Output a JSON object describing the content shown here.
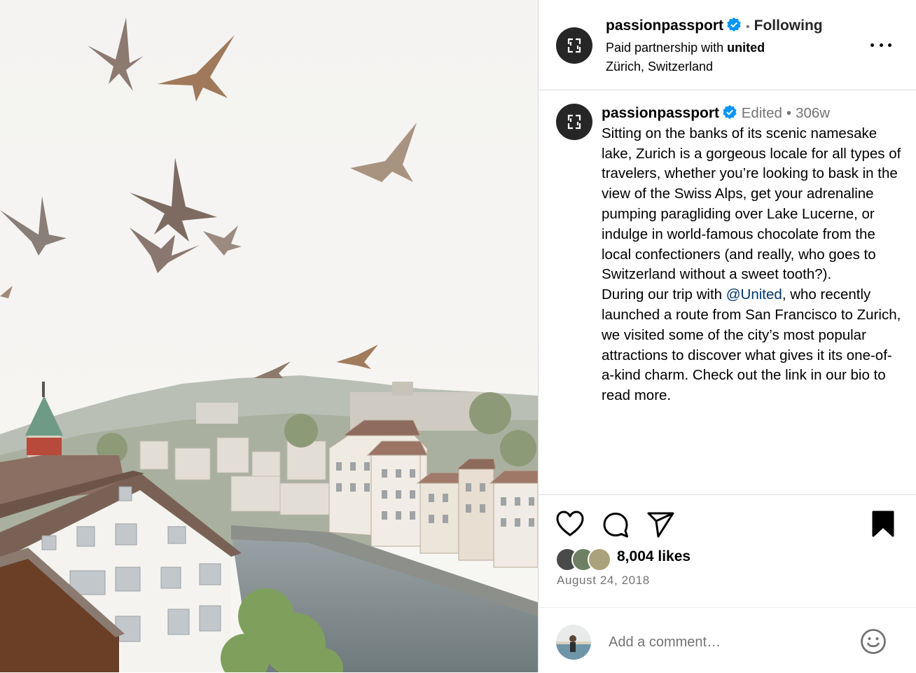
{
  "post": {
    "author": {
      "username": "passionpassport",
      "verified": true,
      "follow_status": "Following",
      "separator": "•",
      "partnership_prefix": "Paid partnership with",
      "partner": "united",
      "location": "Zürich, Switzerland"
    },
    "caption": {
      "username": "passionpassport",
      "edited_label": "Edited",
      "separator": "•",
      "age": "306w",
      "paragraph1": "Sitting on the banks of its scenic namesake lake, Zurich is a gorgeous locale for all types of travelers, whether you’re looking to bask in the view of the Swiss Alps, get your adrenaline pumping paragliding over Lake Lucerne, or indulge in world-famous chocolate from the local confectioners (and really, who goes to Switzerland without a sweet tooth?).",
      "paragraph2_before": "During our trip with ",
      "mention": "@United",
      "paragraph2_after": ", who recently launched a route from San Francisco to Zurich, we visited some of the city’s most popular attractions to discover what gives it its one-of-a-kind charm. Check out the link in our bio to read more."
    },
    "likes": "8,004 likes",
    "date": "August 24, 2018",
    "comment": {
      "placeholder": "Add a comment…"
    },
    "icons": {
      "like": "heart-icon",
      "comment": "comment-icon",
      "share": "paper-plane-icon",
      "save": "bookmark-icon",
      "more": "more-options-icon",
      "emoji": "emoji-icon",
      "verified": "verified-badge-icon"
    },
    "colors": {
      "verified_blue": "#0095f6",
      "mention": "#00376b",
      "secondary_text": "#737373",
      "border": "#dbdbdb"
    }
  }
}
